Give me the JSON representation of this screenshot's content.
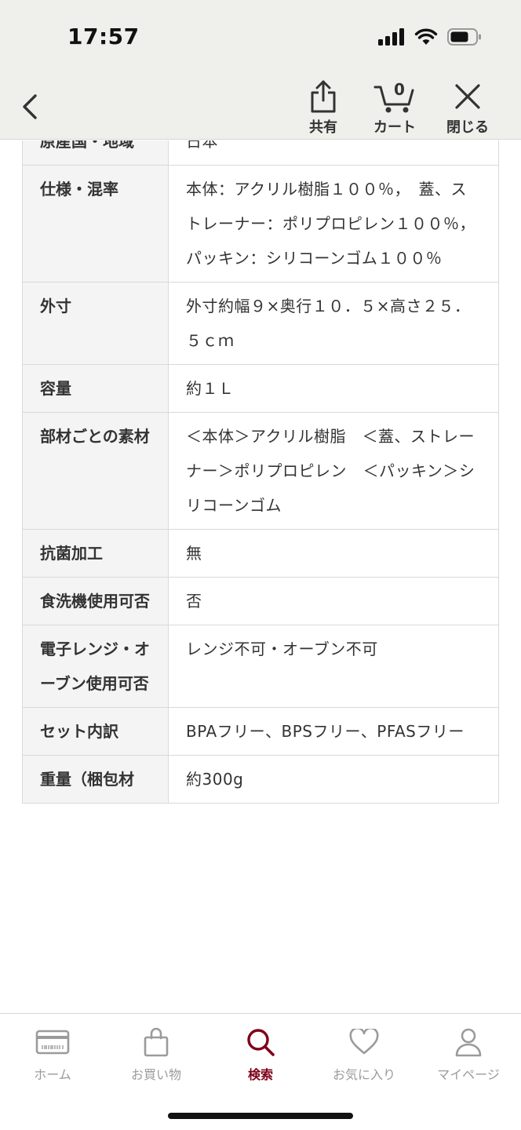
{
  "status_bar": {
    "time": "17:57"
  },
  "nav": {
    "share_label": "共有",
    "cart_label": "カート",
    "cart_count": "0",
    "close_label": "閉じる"
  },
  "spec_rows": [
    {
      "label": "原産国・地域",
      "value": "日本"
    },
    {
      "label": "仕様・混率",
      "value": "本体：アクリル樹脂１００％，　蓋、ストレーナー：ポリプロピレン１００％，　パッキン：シリコーンゴム１００％"
    },
    {
      "label": "外寸",
      "value": "外寸約幅９×奥行１０．５×高さ２５．５ｃｍ"
    },
    {
      "label": "容量",
      "value": "約１Ｌ"
    },
    {
      "label": "部材ごとの素材",
      "value": "＜本体＞アクリル樹脂　＜蓋、ストレーナー＞ポリプロピレン　＜パッキン＞シリコーンゴム"
    },
    {
      "label": "抗菌加工",
      "value": "無"
    },
    {
      "label": "食洗機使用可否",
      "value": "否"
    },
    {
      "label": "電子レンジ・オーブン使用可否",
      "value": "レンジ不可・オーブン不可"
    },
    {
      "label": "セット内訳",
      "value": "BPAフリー、BPSフリー、PFASフリー"
    },
    {
      "label": "重量（梱包材",
      "value": "約300g"
    }
  ],
  "tab_bar": {
    "tabs": [
      {
        "label": "ホーム",
        "icon": "card-icon"
      },
      {
        "label": "お買い物",
        "icon": "shopping-bag-icon"
      },
      {
        "label": "検索",
        "icon": "search-icon"
      },
      {
        "label": "お気に入り",
        "icon": "heart-icon"
      },
      {
        "label": "マイページ",
        "icon": "person-icon"
      }
    ],
    "active_index": 2
  },
  "colors": {
    "accent": "#7f0019",
    "inactive": "#9b9b9b",
    "header_bg": "#efefec"
  }
}
